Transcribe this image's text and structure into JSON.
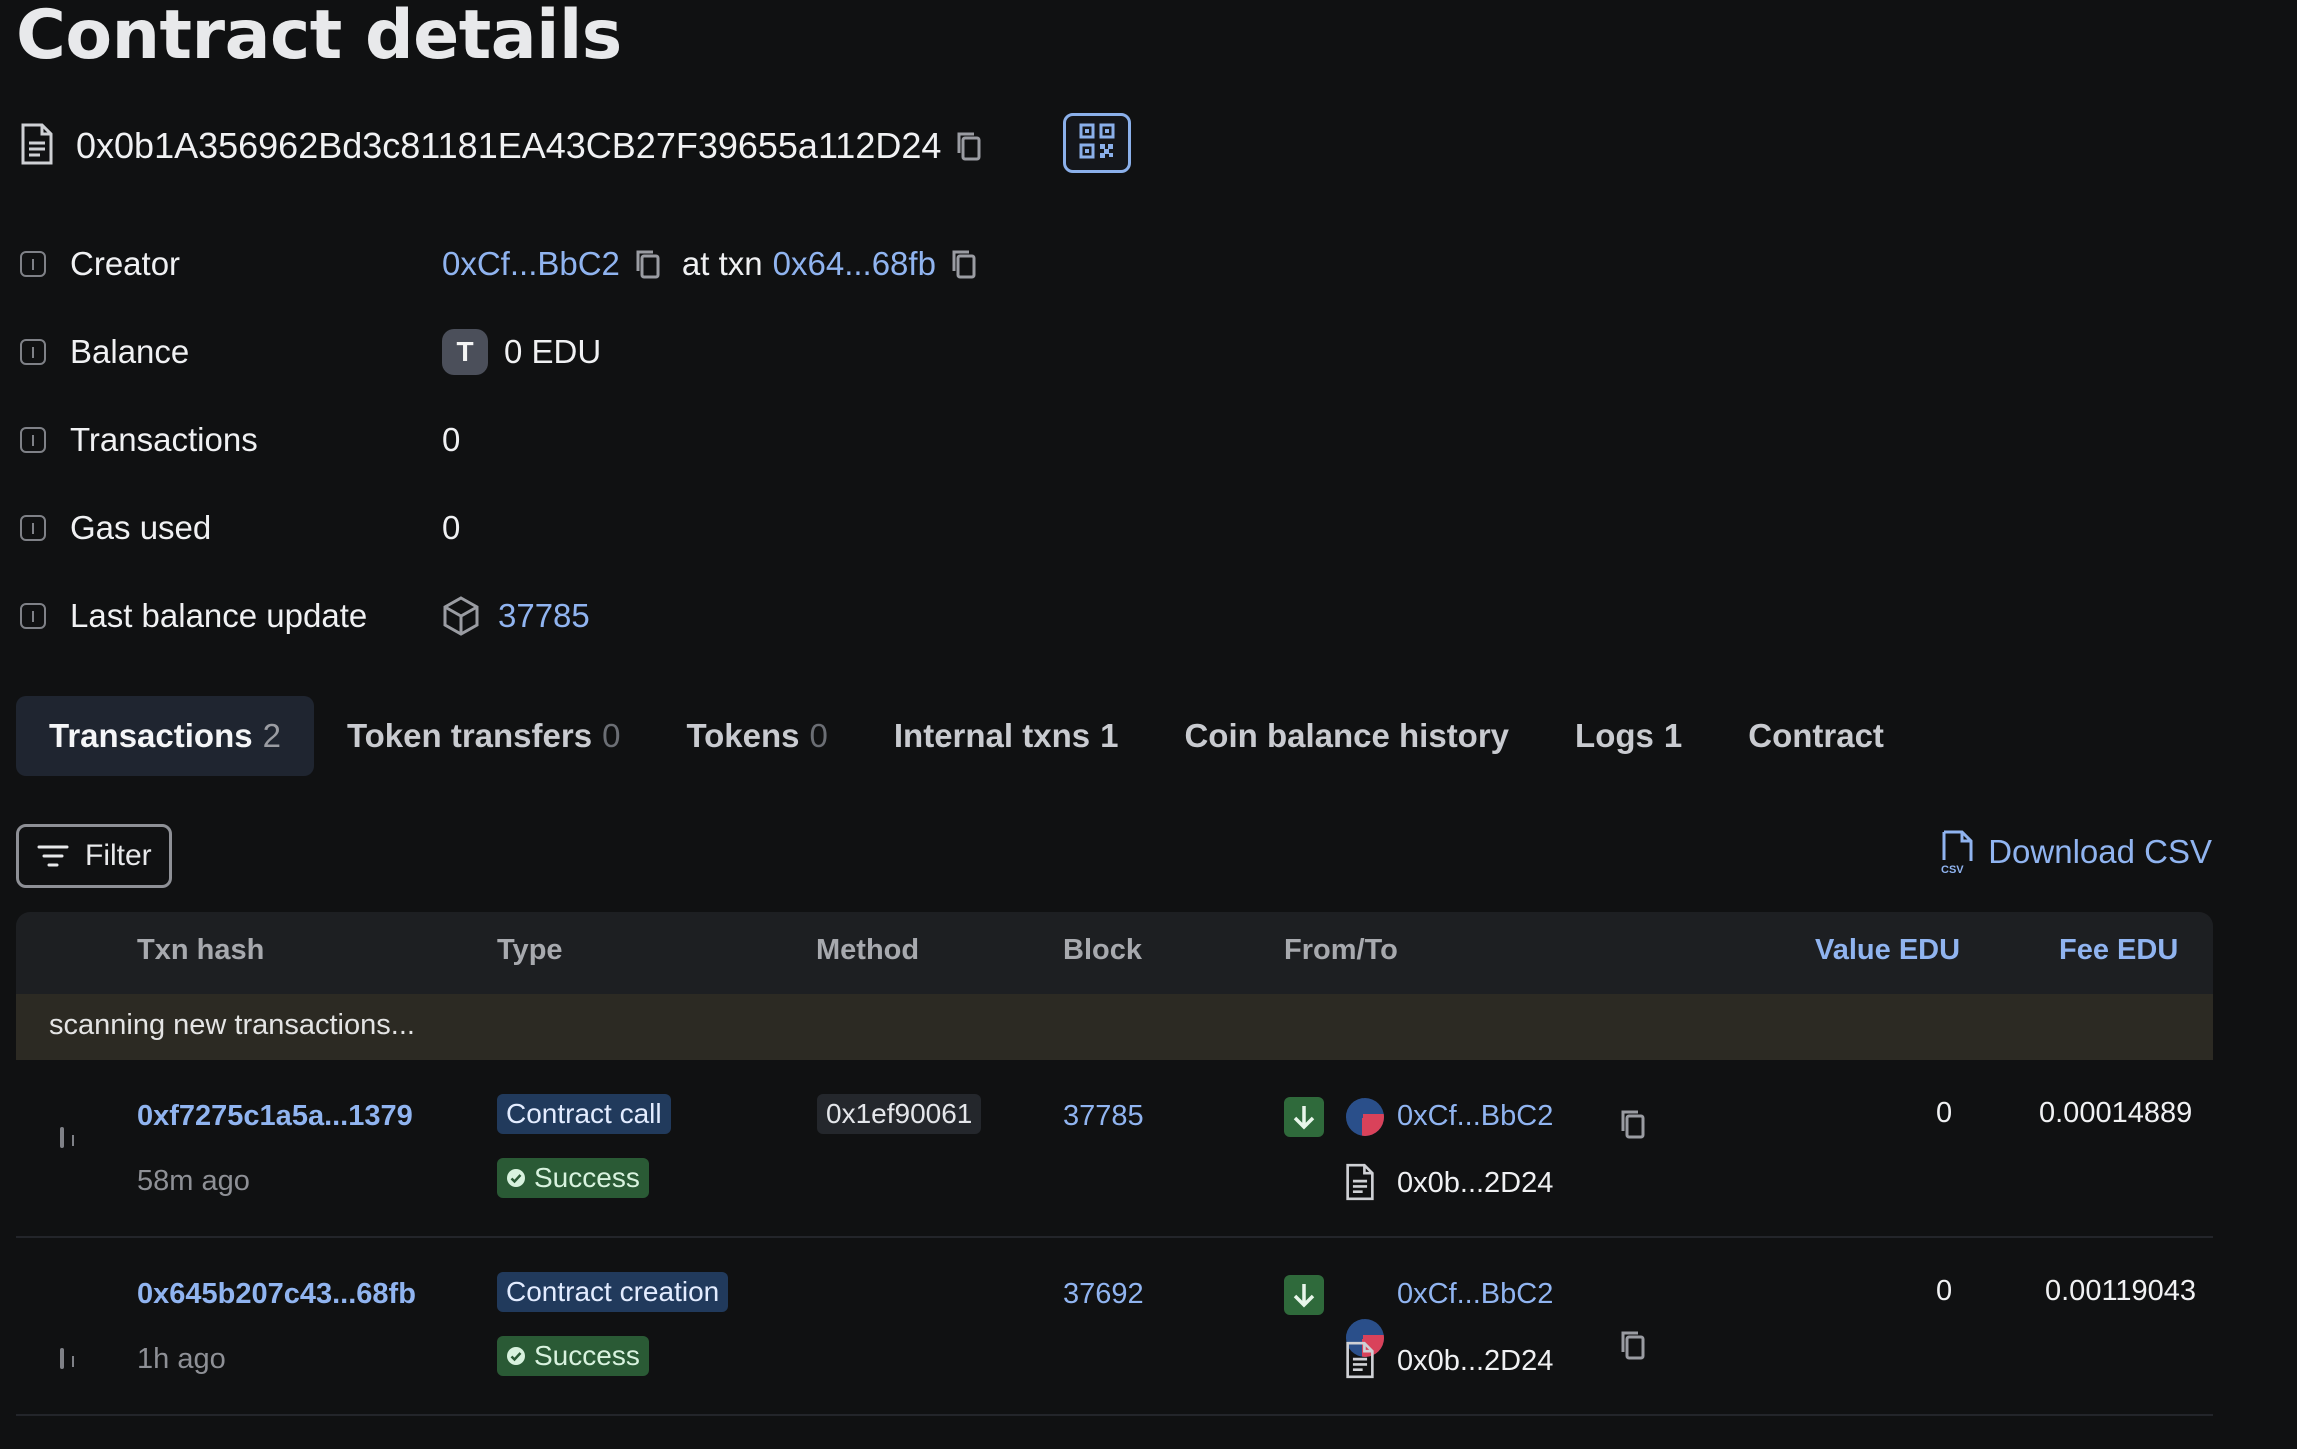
{
  "page": {
    "title": "Contract details"
  },
  "contract": {
    "address": "0x0b1A356962Bd3c81181EA43CB27F39655a112D24",
    "icons": {
      "file": "file-icon",
      "copy": "copy-icon",
      "qr": "qr-code-icon"
    }
  },
  "details": {
    "creator": {
      "label": "Creator",
      "address": "0xCf...BbC2",
      "at_txn_text": "at txn",
      "txn": "0x64...68fb"
    },
    "balance": {
      "label": "Balance",
      "token_letter": "T",
      "value": "0 EDU"
    },
    "transactions": {
      "label": "Transactions",
      "value": "0"
    },
    "gas_used": {
      "label": "Gas used",
      "value": "0"
    },
    "last_balance_update": {
      "label": "Last balance update",
      "value": "37785"
    }
  },
  "tabs": [
    {
      "label": "Transactions",
      "count": "2"
    },
    {
      "label": "Token transfers",
      "count": "0"
    },
    {
      "label": "Tokens",
      "count": "0"
    },
    {
      "label": "Internal txns",
      "count": "1"
    },
    {
      "label": "Coin balance history",
      "count": ""
    },
    {
      "label": "Logs",
      "count": "1"
    },
    {
      "label": "Contract",
      "count": ""
    }
  ],
  "toolbar": {
    "filter_label": "Filter",
    "download_label": "Download CSV",
    "csv_icon_text": "CSV"
  },
  "table": {
    "headers": {
      "txn_hash": "Txn hash",
      "type": "Type",
      "method": "Method",
      "block": "Block",
      "from_to": "From/To",
      "value": "Value EDU",
      "fee": "Fee EDU"
    },
    "scanning_text": "scanning new transactions...",
    "rows": [
      {
        "hash": "0xf7275c1a5a...1379",
        "age": "58m ago",
        "type": "Contract call",
        "status": "Success",
        "method": "0x1ef90061",
        "block": "37785",
        "from": "0xCf...BbC2",
        "to": "0x0b...2D24",
        "value": "0",
        "fee": "0.00014889"
      },
      {
        "hash": "0x645b207c43...68fb",
        "age": "1h ago",
        "type": "Contract creation",
        "status": "Success",
        "method": "",
        "block": "37692",
        "from": "0xCf...BbC2",
        "to": "0x0b...2D24",
        "value": "0",
        "fee": "0.00119043"
      }
    ]
  },
  "colors": {
    "background": "#101112",
    "link": "#90b4f0",
    "success": "#2a5a35",
    "type_tag": "#213a5c"
  }
}
